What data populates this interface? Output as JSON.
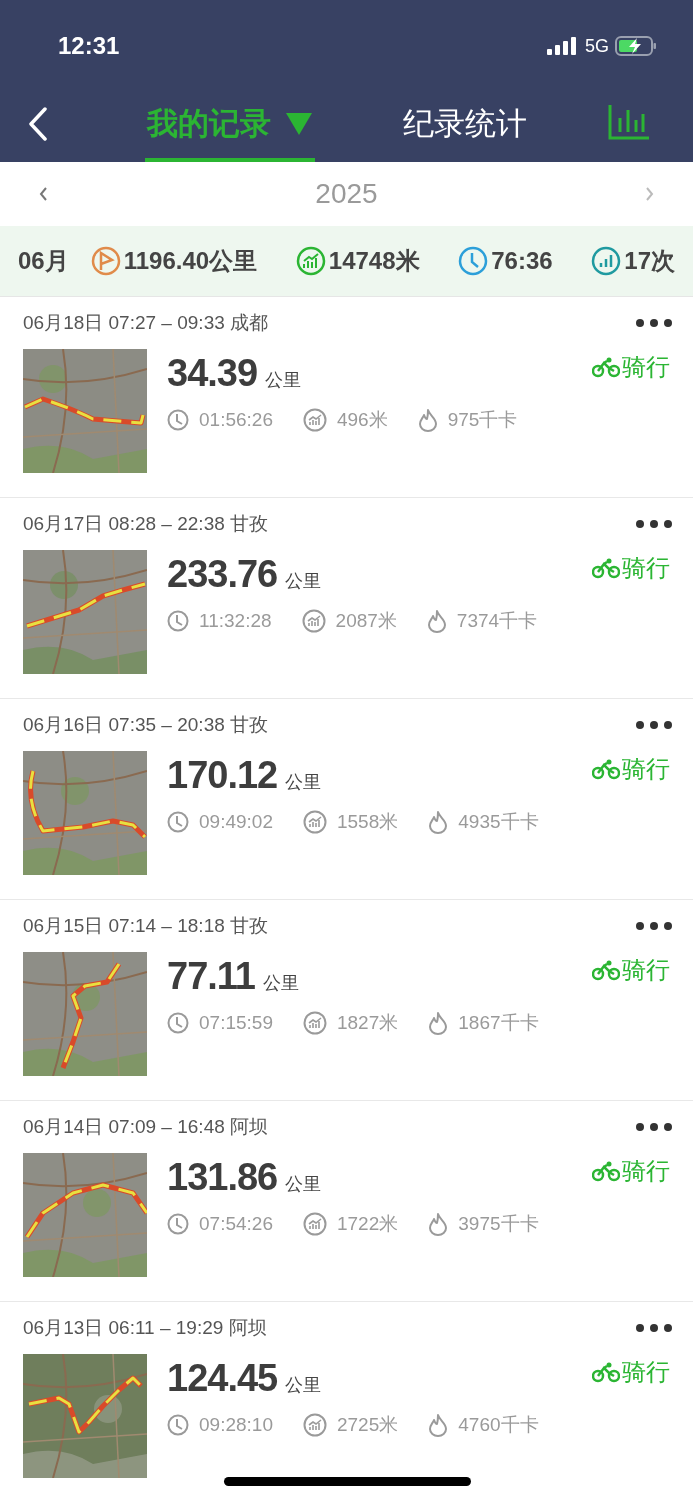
{
  "status_bar": {
    "time": "12:31",
    "network": "5G"
  },
  "nav": {
    "tabs": [
      {
        "label": "我的记录",
        "selected": true,
        "dropdown": true
      },
      {
        "label": "纪录统计",
        "selected": false,
        "dropdown": false
      }
    ]
  },
  "year_picker": {
    "year": "2025"
  },
  "summary": {
    "month": "06月",
    "items": [
      {
        "kind": "distance",
        "value": "1196.40公里"
      },
      {
        "kind": "climb",
        "value": "14748米"
      },
      {
        "kind": "time",
        "value": "76:36"
      },
      {
        "kind": "count",
        "value": "17次"
      }
    ]
  },
  "records": [
    {
      "title": "06月18日 07:27 – 09:33 成都",
      "distance": "34.39",
      "unit": "公里",
      "duration": "01:56:26",
      "climb": "496米",
      "calories": "975千卡",
      "sport": "骑行"
    },
    {
      "title": "06月17日 08:28 – 22:38 甘孜",
      "distance": "233.76",
      "unit": "公里",
      "duration": "11:32:28",
      "climb": "2087米",
      "calories": "7374千卡",
      "sport": "骑行"
    },
    {
      "title": "06月16日 07:35 – 20:38 甘孜",
      "distance": "170.12",
      "unit": "公里",
      "duration": "09:49:02",
      "climb": "1558米",
      "calories": "4935千卡",
      "sport": "骑行"
    },
    {
      "title": "06月15日 07:14 – 18:18 甘孜",
      "distance": "77.11",
      "unit": "公里",
      "duration": "07:15:59",
      "climb": "1827米",
      "calories": "1867千卡",
      "sport": "骑行"
    },
    {
      "title": "06月14日 07:09 – 16:48 阿坝",
      "distance": "131.86",
      "unit": "公里",
      "duration": "07:54:26",
      "climb": "1722米",
      "calories": "3975千卡",
      "sport": "骑行"
    },
    {
      "title": "06月13日 06:11 – 19:29 阿坝",
      "distance": "124.45",
      "unit": "公里",
      "duration": "09:28:10",
      "climb": "2725米",
      "calories": "4760千卡",
      "sport": "骑行"
    }
  ]
}
